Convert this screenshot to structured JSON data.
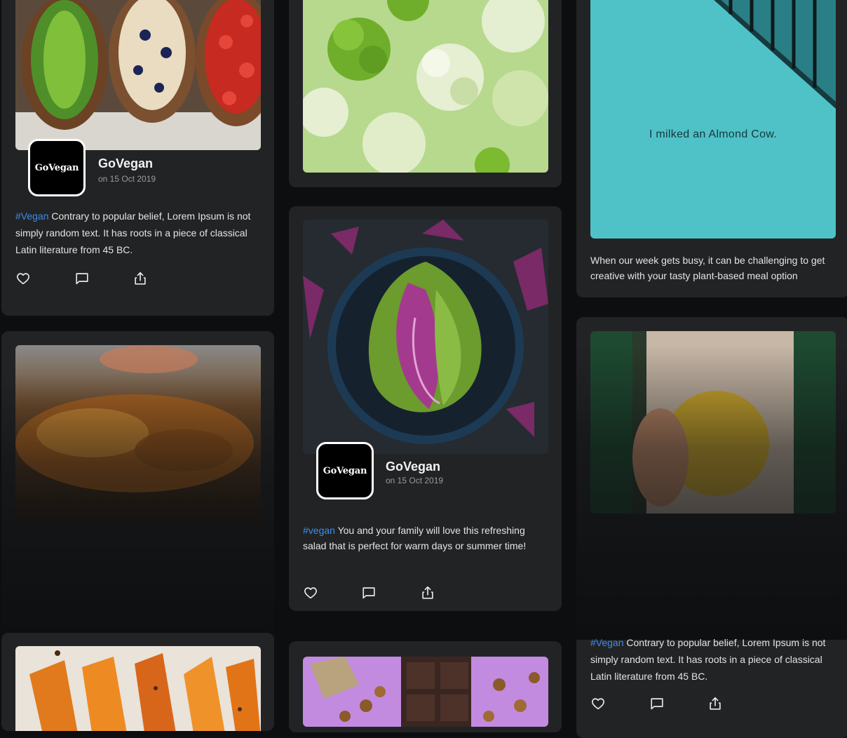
{
  "posts": [
    {
      "username": "GoVegan",
      "avatar_text": "GoVegan",
      "date": "on 15 Oct 2019",
      "tag": "#Vegan",
      "text": " Contrary to popular belief, Lorem Ipsum is not simply random text. It has roots in a piece of classical Latin literature from 45 BC."
    },
    {
      "username": "GoVegan",
      "avatar_text": "GoVegan",
      "date": "on 15 Oct 2019",
      "tag": "#vegan",
      "text": " You and your family will love this refreshing salad that is perfect for warm days or summer time!"
    },
    {
      "wall_text": "I milked an Almond Cow.",
      "text": "When our week gets busy, it can be challenging to get creative with your tasty plant-based meal option"
    },
    {
      "tag": "#Vegan",
      "text": " Contrary to popular belief, Lorem Ipsum is not simply random text. It has roots in a piece of classical Latin literature from 45 BC."
    }
  ],
  "actions": {
    "like": "heart-icon",
    "comment": "comment-icon",
    "share": "share-icon"
  },
  "colors": {
    "background": "#0d0e10",
    "card": "#222325",
    "hashtag": "#3a8ee8"
  }
}
